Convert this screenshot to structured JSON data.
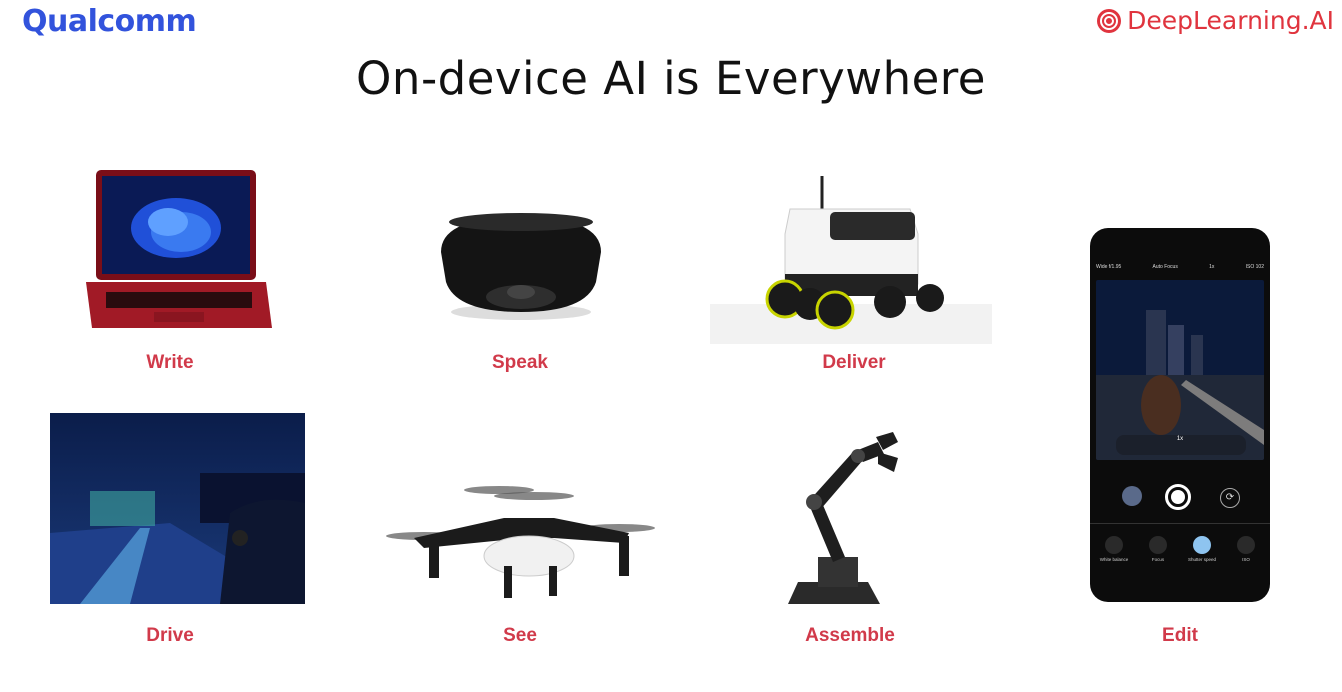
{
  "header": {
    "left_logo": "Qualcomm",
    "right_logo": "DeepLearning.AI"
  },
  "title": "On-device AI is Everywhere",
  "colors": {
    "label": "#D13A4A",
    "qualcomm_blue": "#3253DC",
    "deeplearning_red": "#E0343E"
  },
  "items": [
    {
      "label": "Write",
      "image": "laptop"
    },
    {
      "label": "Speak",
      "image": "smart-speaker"
    },
    {
      "label": "Deliver",
      "image": "delivery-robot"
    },
    {
      "label": "Drive",
      "image": "night-driving"
    },
    {
      "label": "See",
      "image": "drone"
    },
    {
      "label": "Assemble",
      "image": "robotic-arm"
    },
    {
      "label": "Edit",
      "image": "smartphone-camera"
    }
  ],
  "phone_ui": {
    "top_left": "Wide f/1.95",
    "top_center": "Auto Focus",
    "top_mid": "1x",
    "top_right": "ISO 102",
    "zoom": "1x",
    "controls": [
      "White balance",
      "Focus",
      "Shutter speed",
      "ISO"
    ]
  }
}
